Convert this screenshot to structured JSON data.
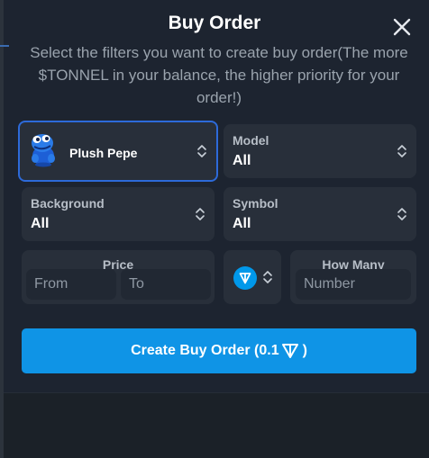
{
  "modal": {
    "title": "Buy Order",
    "subtitle": "Select the filters you want to create buy order(The more $TONNEL in your balance, the higher priority for your order!)"
  },
  "filters": {
    "gift": {
      "name": "Plush Pepe",
      "icon": "plush-pepe-icon"
    },
    "model": {
      "label": "Model",
      "value": "All"
    },
    "background": {
      "label": "Background",
      "value": "All"
    },
    "symbol": {
      "label": "Symbol",
      "value": "All"
    }
  },
  "price": {
    "label": "Price",
    "from_placeholder": "From",
    "to_placeholder": "To"
  },
  "currency": {
    "icon": "ton-icon",
    "color": "#0098ea"
  },
  "how_many": {
    "label": "How Many",
    "placeholder": "Number"
  },
  "create_button": {
    "label_prefix": "Create Buy Order (0.1",
    "label_suffix": ")"
  },
  "colors": {
    "accent": "#0f94e6",
    "selected_border": "#2d6ad9",
    "card_bg": "#282f3a"
  }
}
